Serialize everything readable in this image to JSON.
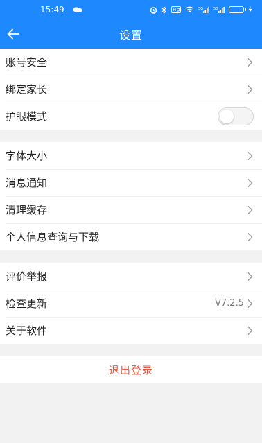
{
  "statusbar": {
    "time": "15:49",
    "icons": [
      "message-icon",
      "alarm-icon",
      "bluetooth-icon",
      "hd-icon",
      "wifi-icon",
      "signal-icon",
      "signal-icon",
      "battery-icon"
    ]
  },
  "header": {
    "title": "设置",
    "back_icon": "back-arrow-icon"
  },
  "groups": [
    {
      "items": [
        {
          "label": "账号安全",
          "type": "link"
        },
        {
          "label": "绑定家长",
          "type": "link"
        },
        {
          "label": "护眼模式",
          "type": "toggle",
          "on": false
        }
      ]
    },
    {
      "items": [
        {
          "label": "字体大小",
          "type": "link"
        },
        {
          "label": "消息通知",
          "type": "link"
        },
        {
          "label": "清理缓存",
          "type": "link"
        },
        {
          "label": "个人信息查询与下载",
          "type": "link"
        }
      ]
    },
    {
      "items": [
        {
          "label": "评价举报",
          "type": "link"
        },
        {
          "label": "检查更新",
          "type": "link",
          "value": "V7.2.5"
        },
        {
          "label": "关于软件",
          "type": "link"
        }
      ]
    }
  ],
  "logout_label": "退出登录",
  "colors": {
    "accent": "#1e88ff",
    "logout_text": "#e35d4d",
    "background": "#f2f2f2"
  }
}
